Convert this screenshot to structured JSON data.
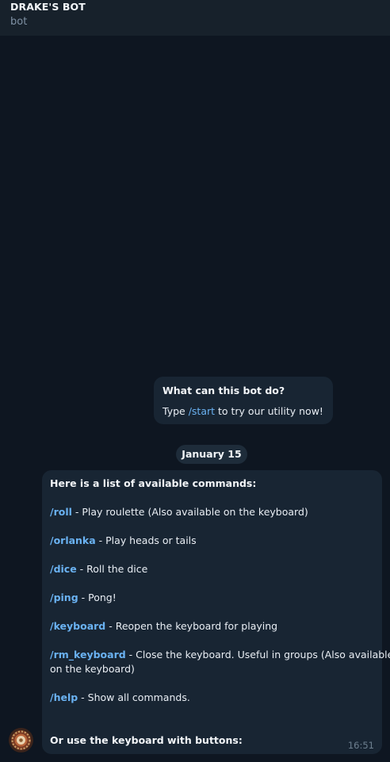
{
  "header": {
    "title": "DRAKE'S BOT",
    "subtitle": "bot"
  },
  "info_card": {
    "title": "What can this bot do?",
    "text_before": "Type ",
    "command": "/start",
    "text_after": " to try our utility now!"
  },
  "date_separator": "January 15",
  "message": {
    "heading": "Here is a list of available commands:",
    "commands": [
      {
        "cmd": "/roll",
        "desc": " - Play roulette (Also available on the keyboard)"
      },
      {
        "cmd": "/orlanka",
        "desc": " - Play heads or tails"
      },
      {
        "cmd": "/dice",
        "desc": " - Roll the dice"
      },
      {
        "cmd": "/ping",
        "desc": " - Pong!"
      },
      {
        "cmd": "/keyboard",
        "desc": " - Reopen the keyboard for playing"
      },
      {
        "cmd": "/rm_keyboard",
        "desc": " - Close the keyboard. Useful in groups (Also available",
        "desc_cont": "on the keyboard)"
      },
      {
        "cmd": "/help",
        "desc": " - Show all commands."
      }
    ],
    "footer": "Or use the keyboard with buttons:",
    "time": "16:51"
  },
  "colors": {
    "background": "#0e1621",
    "header": "#17212b",
    "bubble": "#182533",
    "link": "#6ab2f2"
  },
  "icons": {
    "avatar": "roulette-wheel-avatar"
  }
}
